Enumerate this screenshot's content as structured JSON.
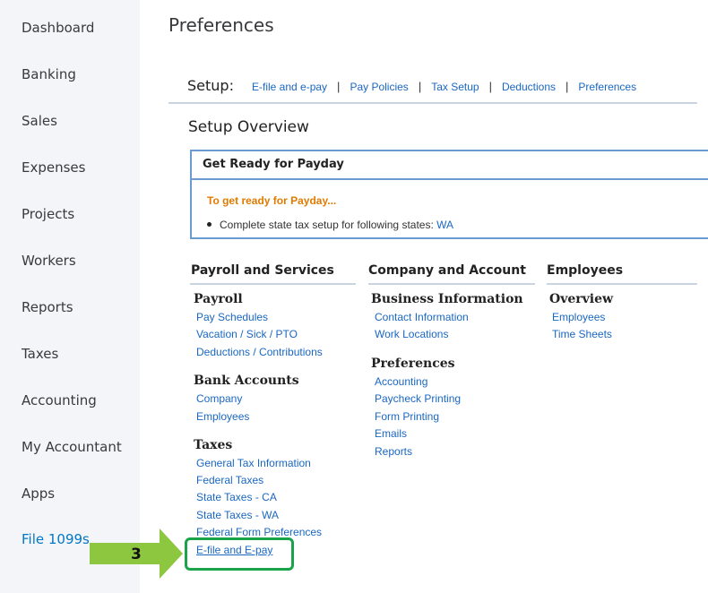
{
  "sidebar": {
    "items": [
      {
        "label": "Dashboard"
      },
      {
        "label": "Banking"
      },
      {
        "label": "Sales"
      },
      {
        "label": "Expenses"
      },
      {
        "label": "Projects"
      },
      {
        "label": "Workers"
      },
      {
        "label": "Reports"
      },
      {
        "label": "Taxes"
      },
      {
        "label": "Accounting"
      },
      {
        "label": "My Accountant"
      },
      {
        "label": "Apps"
      },
      {
        "label": "File 1099s"
      }
    ]
  },
  "page_title": "Preferences",
  "setup": {
    "label": "Setup:",
    "separator": "|",
    "links": [
      "E-file and e-pay",
      "Pay Policies",
      "Tax Setup",
      "Deductions",
      "Preferences"
    ]
  },
  "overview_title": "Setup Overview",
  "ready": {
    "title": "Get Ready for Payday",
    "subtitle": "To get ready for Payday...",
    "item_text": "Complete state tax setup for following states: ",
    "item_link": "WA"
  },
  "columns": [
    {
      "heading": "Payroll and Services",
      "sections": [
        {
          "title": "Payroll",
          "links": [
            "Pay Schedules",
            "Vacation / Sick / PTO",
            "Deductions / Contributions"
          ]
        },
        {
          "title": "Bank Accounts",
          "links": [
            "Company",
            "Employees"
          ]
        },
        {
          "title": "Taxes",
          "links": [
            "General Tax Information",
            "Federal Taxes",
            "State Taxes - CA",
            "State Taxes - WA",
            "Federal Form Preferences",
            "E-file and E-pay"
          ]
        }
      ]
    },
    {
      "heading": "Company and Account",
      "sections": [
        {
          "title": "Business Information",
          "links": [
            "Contact Information",
            "Work Locations"
          ]
        },
        {
          "title": "Preferences",
          "links": [
            "Accounting",
            "Paycheck Printing",
            "Form Printing",
            "Emails",
            "Reports"
          ]
        }
      ]
    },
    {
      "heading": "Employees",
      "sections": [
        {
          "title": "Overview",
          "links": [
            "Employees",
            "Time Sheets"
          ]
        }
      ]
    }
  ],
  "annotation": {
    "step_number": "3",
    "arrow_color": "#8dc63f",
    "highlight_color": "#1aa34a"
  }
}
